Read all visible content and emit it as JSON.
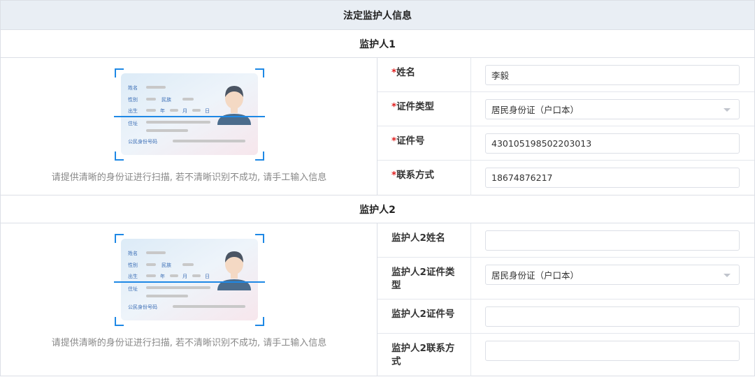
{
  "header": {
    "title": "法定监护人信息"
  },
  "guardian1": {
    "title": "监护人1",
    "scan_hint": "请提供清晰的身份证进行扫描, 若不清晰识别不成功, 请手工输入信息",
    "fields": [
      {
        "label": "姓名",
        "required": "*",
        "value": "李毅"
      },
      {
        "label": "证件类型",
        "required": "*",
        "value": "居民身份证（户口本）"
      },
      {
        "label": "证件号",
        "required": "*",
        "value": "430105198502203013"
      },
      {
        "label": "联系方式",
        "required": "*",
        "value": "18674876217"
      }
    ]
  },
  "guardian2": {
    "title": "监护人2",
    "scan_hint": "请提供清晰的身份证进行扫描, 若不清晰识别不成功, 请手工输入信息",
    "fields": [
      {
        "label": "监护人2姓名",
        "value": ""
      },
      {
        "label": "监护人2证件类型",
        "value": "居民身份证（户口本）"
      },
      {
        "label": "监护人2证件号",
        "value": ""
      },
      {
        "label": "监护人2联系方式",
        "value": ""
      }
    ]
  },
  "id_card": {
    "name_label": "姓名",
    "gender_label": "性别",
    "ethnicity_label": "民族",
    "birth_label": "出生",
    "year_label": "年",
    "month_label": "月",
    "day_label": "日",
    "address_label": "住址",
    "id_number_label": "公民身份号码"
  },
  "colors": {
    "accent": "#1e88e5",
    "required": "#e02020",
    "header_bg": "#e9eef4"
  }
}
